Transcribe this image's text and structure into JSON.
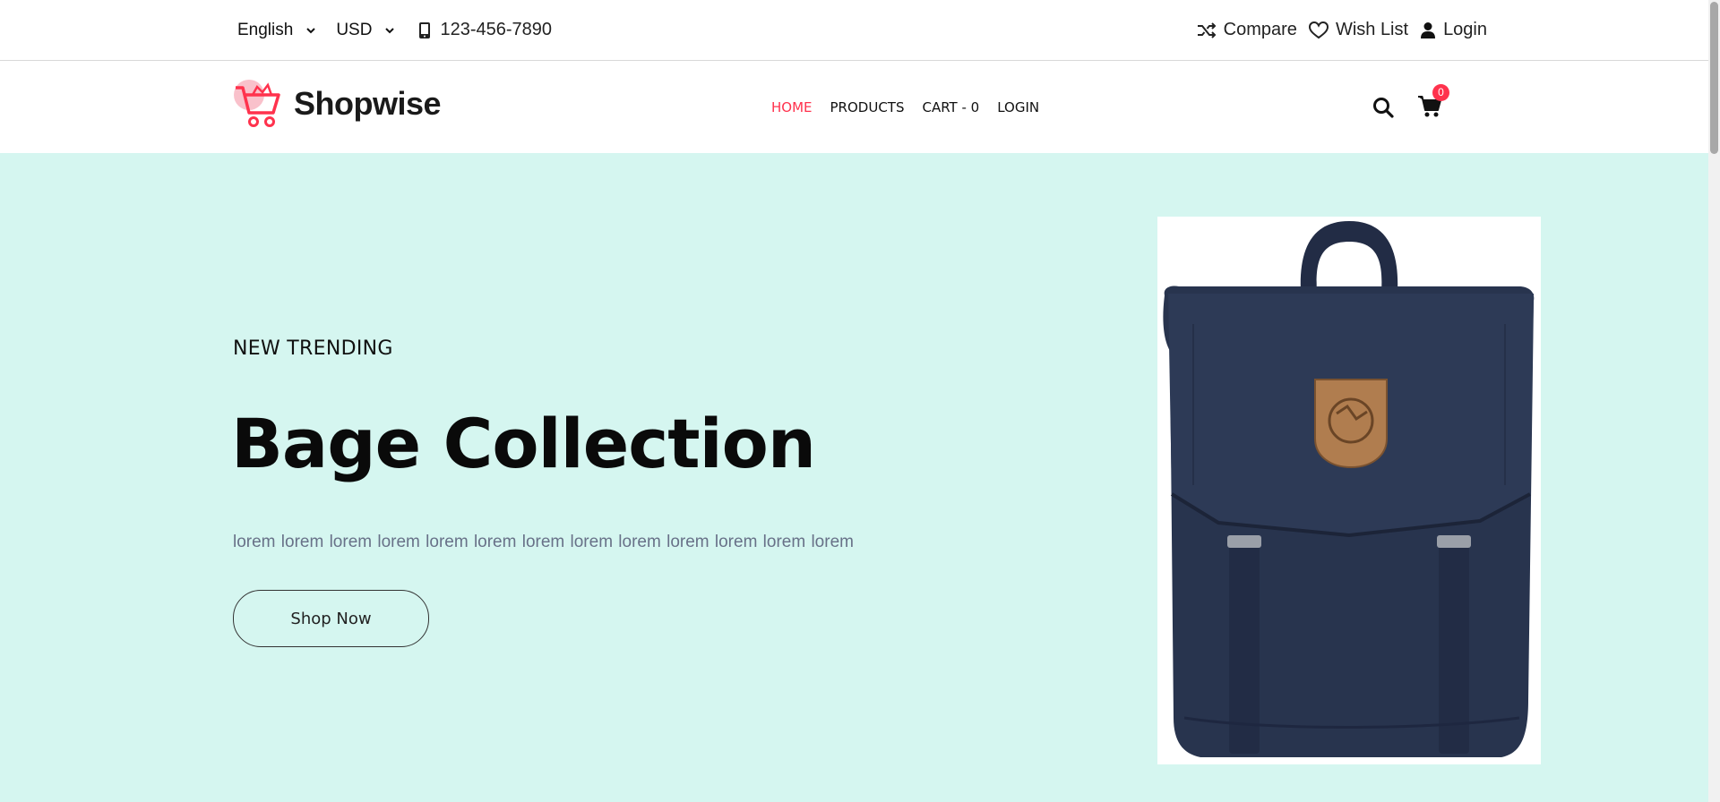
{
  "topbar": {
    "language": "English",
    "currency": "USD",
    "phone": "123-456-7890",
    "compare": "Compare",
    "wishlist": "Wish List",
    "login": "Login"
  },
  "header": {
    "logo_text": "Shopwise",
    "nav": {
      "home": "HOME",
      "products": "PRODUCTS",
      "cart": "CART - 0",
      "login": "LOGIN"
    },
    "cart_count": "0"
  },
  "hero": {
    "kicker": "NEW TRENDING",
    "title": "Bage Collection",
    "description": "lorem lorem lorem lorem lorem lorem lorem lorem lorem lorem lorem lorem lorem",
    "button": "Shop Now",
    "image_subject": "navy-backpack"
  },
  "colors": {
    "accent": "#ff324d",
    "hero_bg": "#d5f6f0",
    "backpack": "#28344e",
    "patch": "#b07d4f"
  },
  "icons": [
    "chevron-down-icon",
    "phone-icon",
    "shuffle-icon",
    "heart-icon",
    "user-icon",
    "search-icon",
    "cart-icon"
  ]
}
